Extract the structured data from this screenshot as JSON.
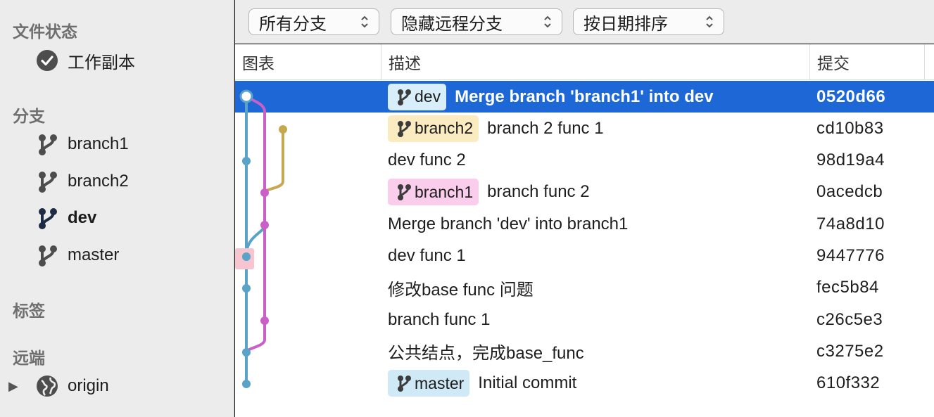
{
  "sidebar": {
    "file_status_header": "文件状态",
    "working_copy": "工作副本",
    "branches_header": "分支",
    "branches": [
      "branch1",
      "branch2",
      "dev",
      "master"
    ],
    "active_branch": "dev",
    "tags_header": "标签",
    "remotes_header": "远端",
    "remotes": [
      "origin"
    ]
  },
  "toolbar": {
    "branch_filter": "所有分支",
    "remote_filter": "隐藏远程分支",
    "sort_order": "按日期排序"
  },
  "columns": {
    "graph": "图表",
    "description": "描述",
    "commit": "提交"
  },
  "commits": [
    {
      "badge": "dev",
      "badge_color": "blue",
      "message": "Merge branch 'branch1' into dev",
      "hash": "0520d66",
      "selected": true
    },
    {
      "badge": "branch2",
      "badge_color": "yellow",
      "message": "branch 2 func 1",
      "hash": "cd10b83"
    },
    {
      "badge": "",
      "badge_color": "",
      "message": "dev func 2",
      "hash": "98d19a4"
    },
    {
      "badge": "branch1",
      "badge_color": "pink",
      "message": "branch func 2",
      "hash": "0acedcb"
    },
    {
      "badge": "",
      "badge_color": "",
      "message": "Merge branch 'dev' into branch1",
      "hash": "74a8d10"
    },
    {
      "badge": "",
      "badge_color": "",
      "message": "dev func 1",
      "hash": "9447776"
    },
    {
      "badge": "",
      "badge_color": "",
      "message": "修改base func 问题",
      "hash": "fec5b84"
    },
    {
      "badge": "",
      "badge_color": "",
      "message": "branch func 1",
      "hash": "c26c5e3"
    },
    {
      "badge": "",
      "badge_color": "",
      "message": "公共结点，完成base_func",
      "hash": "c3275e2"
    },
    {
      "badge": "master",
      "badge_color": "blue",
      "message": "Initial commit",
      "hash": "610f332"
    }
  ],
  "colors": {
    "selection": "#1d68d6",
    "lane_blue": "#5aa3c8",
    "lane_pink": "#c95fc7",
    "lane_gold": "#c6a850",
    "badge_blue": "#cfe9f7",
    "badge_yellow": "#fbebc0",
    "badge_pink": "#f9cdeb"
  },
  "icons": {
    "working_copy": "checkmark-circle-icon",
    "branch": "branch-icon",
    "remote": "globe-icon",
    "popup": "chevron-updown-icon"
  }
}
